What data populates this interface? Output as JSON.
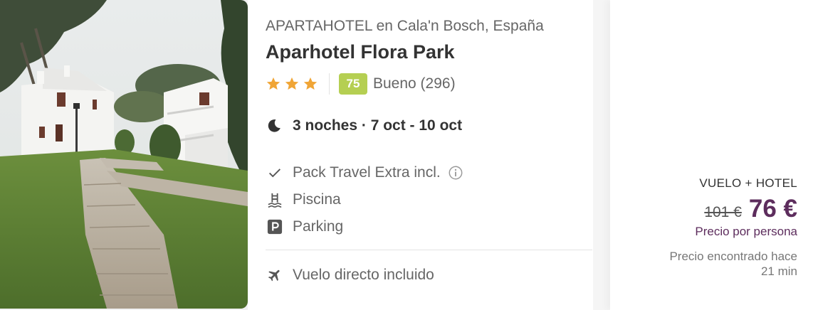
{
  "hotel": {
    "category_location": "APARTAHOTEL en Cala'n Bosch, España",
    "name": "Aparhotel Flora Park",
    "stars": 3,
    "score": "75",
    "rating_text": "Bueno (296)",
    "nights_dates": "3 noches · 7 oct - 10 oct"
  },
  "features": [
    {
      "icon": "checkmark-icon",
      "label": "Pack Travel Extra incl."
    },
    {
      "icon": "pool-icon",
      "label": "Piscina"
    },
    {
      "icon": "parking-icon",
      "label": "Parking"
    }
  ],
  "flight": {
    "icon": "airplane-icon",
    "label": "Vuelo directo incluido"
  },
  "price": {
    "package": "VUELO + HOTEL",
    "old_price": "101 €",
    "new_price": "76 €",
    "per_person": "Precio por persona",
    "found_line1": "Precio encontrado hace",
    "found_line2": "21 min"
  },
  "colors": {
    "score_badge": "#b5cf52",
    "stars": "#f0a536",
    "price_accent": "#5d2d5d"
  }
}
